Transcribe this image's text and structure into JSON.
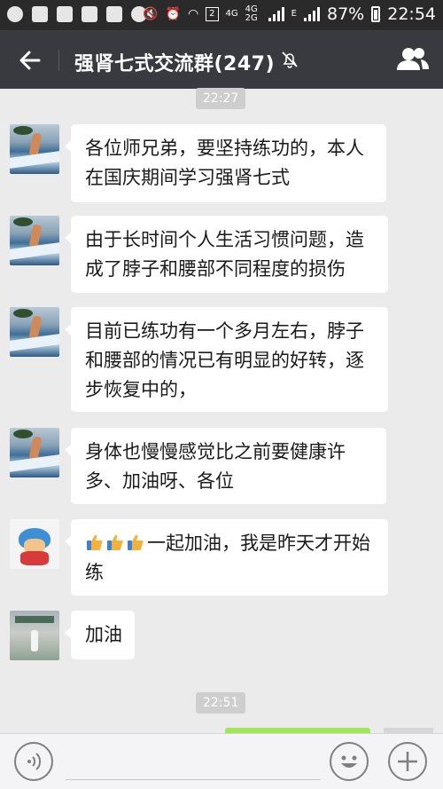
{
  "status_bar": {
    "battery_percent": "87%",
    "time": "22:54",
    "network_4g": "4G",
    "network_4g2g": "4G 2G",
    "edge": "E",
    "sim_badge": "2"
  },
  "header": {
    "title": "强肾七式交流群(247)",
    "icons": {
      "back": "back-arrow-icon",
      "mute": "mute-bell-icon",
      "group": "group-members-icon"
    }
  },
  "chat": {
    "time_1": "22:27",
    "messages": [
      {
        "avatar": "surf-photo",
        "text": "各位师兄弟，要坚持练功的，本人在国庆期间学习强肾七式"
      },
      {
        "avatar": "surf-photo",
        "text": "由于长时间个人生活习惯问题，造成了脖子和腰部不同程度的损伤"
      },
      {
        "avatar": "surf-photo",
        "text": "目前已练功有一个多月左右，脖子和腰部的情况已有明显的好转，逐步恢复中的，"
      },
      {
        "avatar": "surf-photo",
        "text": "身体也慢慢感觉比之前要健康许多、加油呀、各位"
      },
      {
        "avatar": "cartoon",
        "emoji": "thumbs-up x3",
        "text": "一起加油，我是昨天才开始练"
      },
      {
        "avatar": "stadium-photo",
        "text": "加油"
      }
    ],
    "time_2": "22:51"
  },
  "input_bar": {
    "icons": {
      "voice": "voice-icon",
      "emoji": "emoji-icon",
      "more": "plus-icon"
    }
  },
  "colors": {
    "header_bg": "#393a3f",
    "statusbar_bg": "#2a2a2a",
    "chat_bg": "#ebebeb",
    "bubble_bg": "#ffffff",
    "outgoing_bubble": "#9fe658",
    "time_pill": "#cecece"
  }
}
